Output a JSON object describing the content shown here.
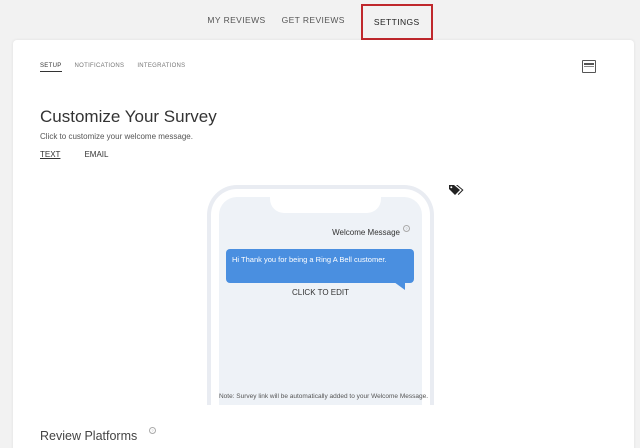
{
  "top_nav": {
    "items": [
      {
        "label": "MY REVIEWS"
      },
      {
        "label": "GET REVIEWS"
      },
      {
        "label": "SETTINGS"
      }
    ]
  },
  "settings_tabs": [
    {
      "label": "SETUP"
    },
    {
      "label": "NOTIFICATIONS"
    },
    {
      "label": "INTEGRATIONS"
    }
  ],
  "page": {
    "title": "Customize Your Survey",
    "subtitle": "Click to customize your welcome message."
  },
  "message_tabs": [
    {
      "label": "TEXT"
    },
    {
      "label": "EMAIL"
    }
  ],
  "phone_preview": {
    "welcome_label": "Welcome Message",
    "info_glyph": "?",
    "message": "Hi Thank you for being a Ring A Bell customer.",
    "click_to_edit": "CLICK TO EDIT"
  },
  "note": "Note: Survey link will be automatically added to your Welcome Message.",
  "review_platforms": {
    "title": "Review Platforms",
    "info_glyph": "?"
  },
  "icons": {
    "layout": "layout-icon",
    "tag": "tag-icon",
    "info": "info-icon"
  },
  "colors": {
    "highlight_border": "#c0282d",
    "bubble": "#4a8fe0",
    "screen_bg": "#eef2f7"
  }
}
